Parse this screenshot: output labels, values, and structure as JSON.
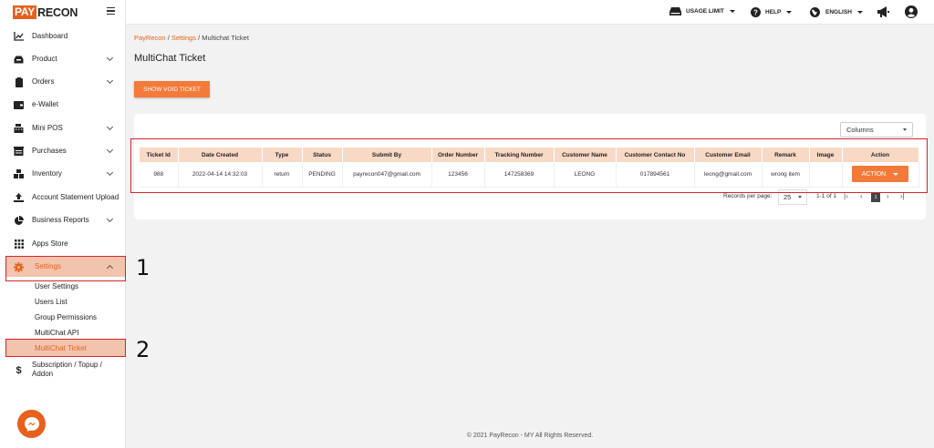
{
  "brand": {
    "logo_left": "PAY",
    "logo_right": "RECON"
  },
  "header": {
    "usage_limit": "USAGE LIMIT",
    "help": "HELP",
    "language": "ENGLISH"
  },
  "sidebar": {
    "items": [
      {
        "label": "Dashboard",
        "icon": "chart-line-icon"
      },
      {
        "label": "Product",
        "icon": "box-icon"
      },
      {
        "label": "Orders",
        "icon": "clipboard-icon"
      },
      {
        "label": "e-Wallet",
        "icon": "wallet-icon"
      },
      {
        "label": "Mini POS",
        "icon": "cash-register-icon"
      },
      {
        "label": "Purchases",
        "icon": "warehouse-icon"
      },
      {
        "label": "Inventory",
        "icon": "boxes-icon"
      },
      {
        "label": "Account Statement Upload",
        "icon": "upload-icon"
      },
      {
        "label": "Business Reports",
        "icon": "pie-chart-icon"
      },
      {
        "label": "Apps Store",
        "icon": "grid-icon"
      },
      {
        "label": "Settings",
        "icon": "gear-icon"
      },
      {
        "label": "Subscription / Topup / Addon",
        "icon": "dollar-icon"
      }
    ],
    "settings_sub": [
      "User Settings",
      "Users List",
      "Group Permissions",
      "MultiChat API",
      "MultiChat Ticket"
    ]
  },
  "annotations": {
    "one": "1",
    "two": "2"
  },
  "breadcrumb": {
    "home": "PayRecon",
    "settings": "Settings",
    "current": "Multichat Ticket"
  },
  "page": {
    "title": "MultiChat Ticket",
    "void_button": "SHOW VOID TICKET",
    "columns_select": "Columns"
  },
  "table": {
    "headers": [
      "Ticket Id",
      "Date Created",
      "Type",
      "Status",
      "Submit By",
      "Order Number",
      "Tracking Number",
      "Customer Name",
      "Customer Contact No",
      "Customer Email",
      "Remark",
      "Image",
      "Action"
    ],
    "rows": [
      [
        "988",
        "2022-04-14 14:32:03",
        "return",
        "PENDING",
        "payrecon047@gmail.com",
        "123456",
        "147258369",
        "LEONG",
        "017894561",
        "leong@gmail.com",
        "wrong item",
        "",
        "ACTION"
      ]
    ]
  },
  "pagination": {
    "records_label": "Records per page:",
    "per_page": "25",
    "range": "1-1 of 1",
    "current": "1"
  },
  "footer": "© 2021 PayRecon - MY All Rights Reserved.",
  "colors": {
    "accent": "#e8601c",
    "accent_light": "#f3c4ad",
    "annotation_red": "#d9232d"
  }
}
